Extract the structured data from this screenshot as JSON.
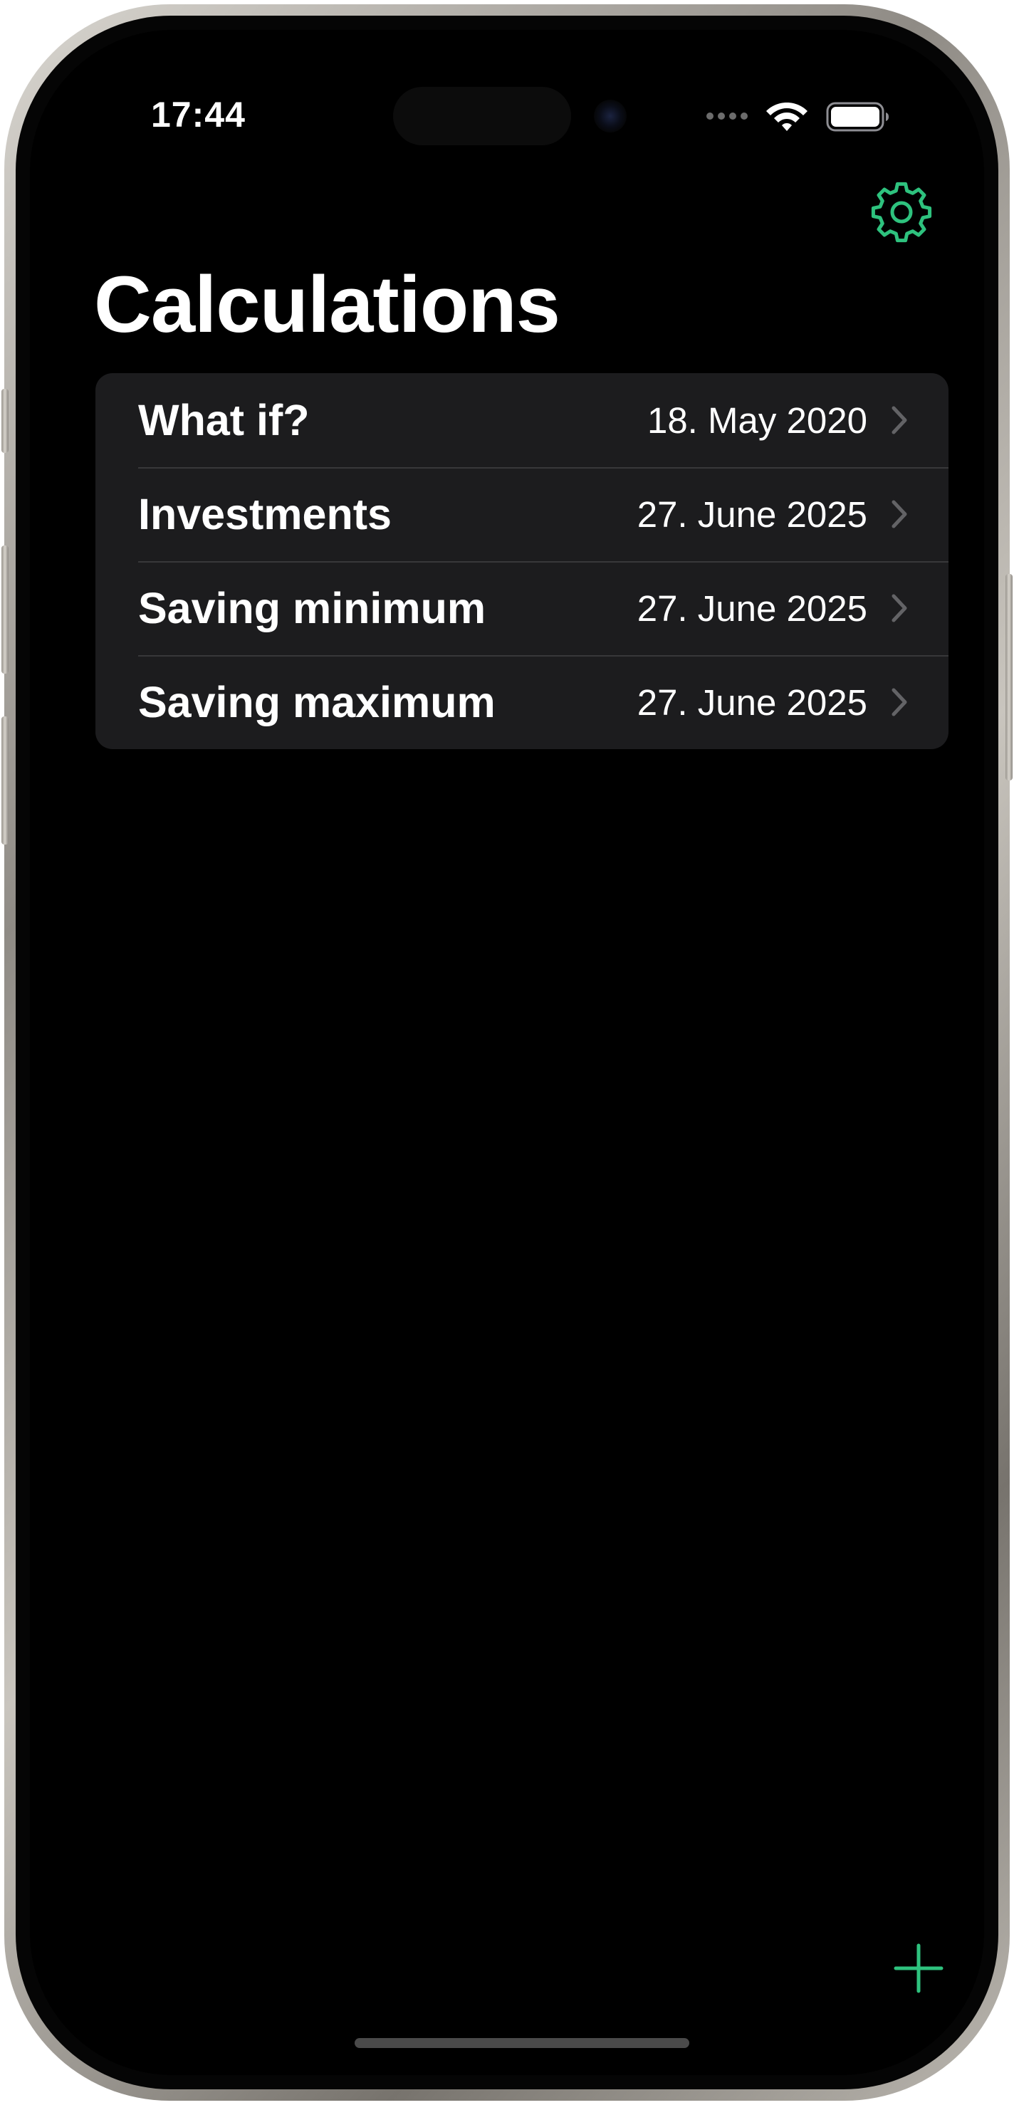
{
  "colors": {
    "accent": "#2ec27e",
    "background": "#000000",
    "card": "#1c1c1e",
    "separator": "#38383a",
    "chevron": "#636366"
  },
  "status_bar": {
    "time": "17:44",
    "icons": [
      "cellular-dots-icon",
      "wifi-icon",
      "battery-icon"
    ]
  },
  "nav": {
    "settings_icon": "gear-icon",
    "title": "Calculations"
  },
  "calculations": [
    {
      "title": "What if?",
      "date": "18. May 2020"
    },
    {
      "title": "Investments",
      "date": "27. June 2025"
    },
    {
      "title": "Saving minimum",
      "date": "27. June 2025"
    },
    {
      "title": "Saving maximum",
      "date": "27. June 2025"
    }
  ],
  "toolbar": {
    "add_icon": "plus-icon"
  }
}
